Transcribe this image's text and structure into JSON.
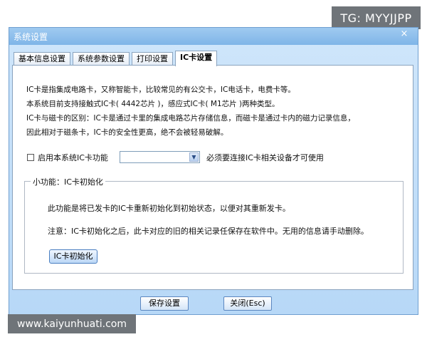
{
  "watermarks": {
    "top_right": "TG: MYYJJPP",
    "bottom_left": "www.kaiyunhuati.com"
  },
  "window": {
    "title": "系统设置",
    "close_glyph": "×"
  },
  "tabs": [
    {
      "label": "基本信息设置",
      "active": false
    },
    {
      "label": "系统参数设置",
      "active": false
    },
    {
      "label": "打印设置",
      "active": false
    },
    {
      "label": "IC卡设置",
      "active": true
    }
  ],
  "ic_panel": {
    "description": [
      "IC卡是指集成电路卡，又称智能卡，比较常见的有公交卡，IC电话卡，电费卡等。",
      "本系统目前支持接触式IC卡( 4442芯片 )，感应式IC卡( M1芯片 )两种类型。",
      "IC卡与磁卡的区别：IC卡是通过卡里的集成电路芯片存储信息，而磁卡是通过卡内的磁力记录信息，",
      "因此相对于磁条卡，IC卡的安全性更高，绝不会被轻易破解。"
    ],
    "enable_label": "启用本系统IC卡功能",
    "enable_checked": false,
    "device_select_value": "",
    "select_hint": "必须要连接IC卡相关设备才可使用",
    "group": {
      "title": "小功能：IC卡初始化",
      "line1": "此功能是将已发卡的IC卡重新初始化到初始状态，以便对其重新发卡。",
      "line2": "注意：IC卡初始化之后，此卡对应的旧的相关记录任保存在软件中。无用的信息请手动删除。",
      "init_button": "IC卡初始化"
    }
  },
  "footer": {
    "save_label": "保存设置",
    "close_label": "关闭(Esc)"
  }
}
